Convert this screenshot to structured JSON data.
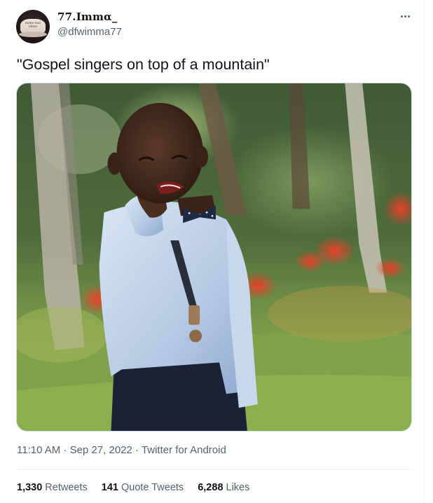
{
  "author": {
    "display_name": "77.𝐈𝐦𝐦𝛂_",
    "handle": "@dfwimma77",
    "avatar_cap_text": "MAKE BAD IDEAS GREAT AGAIN"
  },
  "tweet": {
    "text": "\"Gospel singers on top of a mountain\""
  },
  "meta": {
    "time": "11:10 AM",
    "sep1": " · ",
    "date": "Sep 27, 2022",
    "sep2": " · ",
    "source": "Twitter for Android"
  },
  "stats": {
    "retweets_count": "1,330",
    "retweets_label": "Retweets",
    "quotes_count": "141",
    "quotes_label": "Quote Tweets",
    "likes_count": "6,288",
    "likes_label": "Likes"
  },
  "icons": {
    "more": "more-horizontal-icon"
  },
  "colors": {
    "text_primary": "#0f1419",
    "text_secondary": "#536471",
    "border": "#eff3f4"
  }
}
